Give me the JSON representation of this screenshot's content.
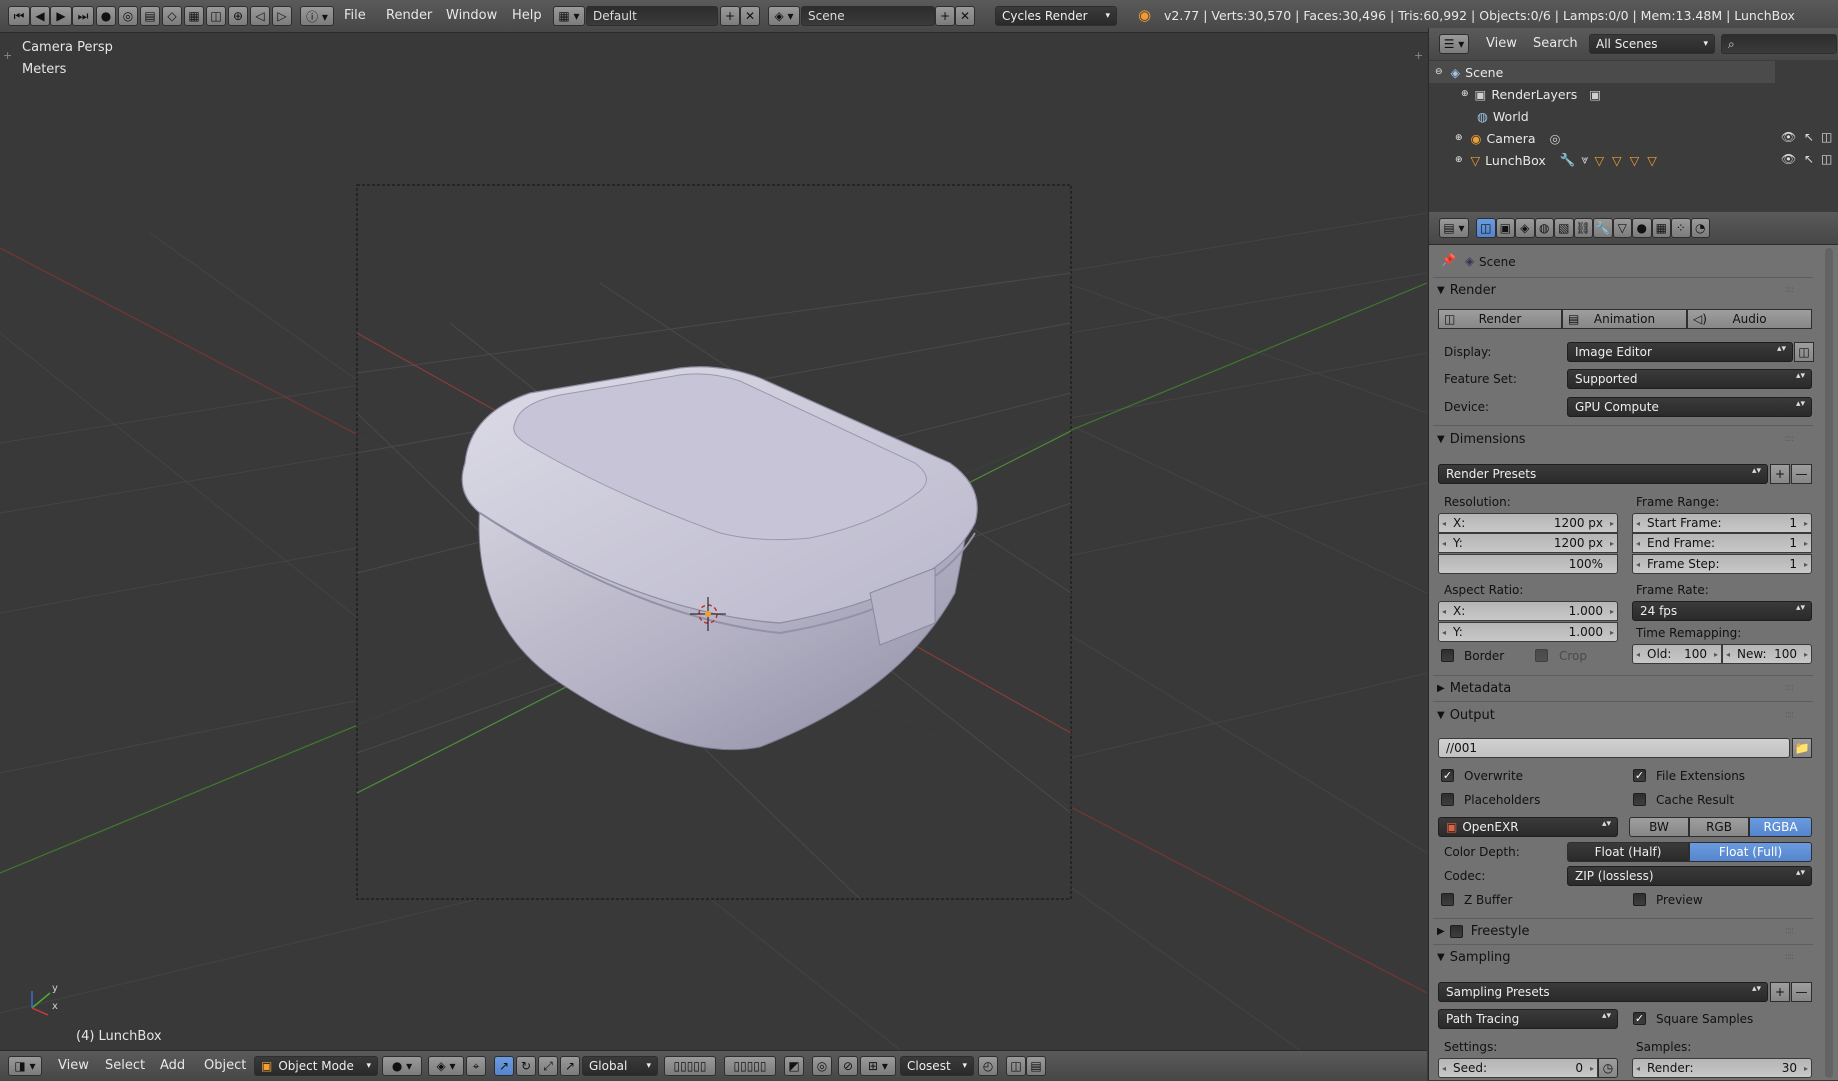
{
  "topbar": {
    "menus": [
      "File",
      "Render",
      "Window",
      "Help"
    ],
    "layout": "Default",
    "scene": "Scene",
    "engine": "Cycles Render",
    "stats": "v2.77 | Verts:30,570 | Faces:30,496 | Tris:60,992 | Objects:0/6 | Lamps:0/0 | Mem:13.48M | LunchBox"
  },
  "viewport": {
    "view_name": "Camera Persp",
    "units": "Meters",
    "object_label": "(4) LunchBox",
    "axis_x": "x",
    "axis_y": "y"
  },
  "bottombar": {
    "menus": [
      "View",
      "Select",
      "Add",
      "Object"
    ],
    "mode": "Object Mode",
    "orientation": "Global",
    "snap": "Closest"
  },
  "outliner": {
    "menus": [
      "View",
      "Search"
    ],
    "filter": "All Scenes",
    "items": [
      "Scene",
      "RenderLayers",
      "World",
      "Camera",
      "LunchBox"
    ]
  },
  "properties": {
    "context": "Scene",
    "render": {
      "title": "Render",
      "buttons": [
        "Render",
        "Animation",
        "Audio"
      ],
      "display_label": "Display:",
      "display": "Image Editor",
      "feature_label": "Feature Set:",
      "feature": "Supported",
      "device_label": "Device:",
      "device": "GPU Compute"
    },
    "dimensions": {
      "title": "Dimensions",
      "presets": "Render Presets",
      "resolution_label": "Resolution:",
      "res_x_label": "X:",
      "res_x": "1200 px",
      "res_y_label": "Y:",
      "res_y": "1200 px",
      "res_pct": "100%",
      "frame_range_label": "Frame Range:",
      "start_label": "Start Frame:",
      "start": "1",
      "end_label": "End Frame:",
      "end": "1",
      "step_label": "Frame Step:",
      "step": "1",
      "aspect_label": "Aspect Ratio:",
      "asp_x_label": "X:",
      "asp_x": "1.000",
      "asp_y_label": "Y:",
      "asp_y": "1.000",
      "frame_rate_label": "Frame Rate:",
      "frame_rate": "24 fps",
      "time_remap_label": "Time Remapping:",
      "old_label": "Old:",
      "old": "100",
      "new_label": "New:",
      "new": "100",
      "border": "Border",
      "crop": "Crop"
    },
    "metadata": {
      "title": "Metadata"
    },
    "output": {
      "title": "Output",
      "path": "//001",
      "overwrite": "Overwrite",
      "file_ext": "File Extensions",
      "placeholders": "Placeholders",
      "cache": "Cache Result",
      "format": "OpenEXR",
      "color_modes": [
        "BW",
        "RGB",
        "RGBA"
      ],
      "depth_label": "Color Depth:",
      "depths": [
        "Float (Half)",
        "Float (Full)"
      ],
      "codec_label": "Codec:",
      "codec": "ZIP (lossless)",
      "zbuffer": "Z Buffer",
      "preview": "Preview"
    },
    "freestyle": {
      "title": "Freestyle"
    },
    "sampling": {
      "title": "Sampling",
      "presets": "Sampling Presets",
      "integrator": "Path Tracing",
      "square": "Square Samples",
      "settings_label": "Settings:",
      "samples_label": "Samples:",
      "seed_label": "Seed:",
      "seed": "0",
      "render_label": "Render:",
      "render": "30"
    }
  }
}
